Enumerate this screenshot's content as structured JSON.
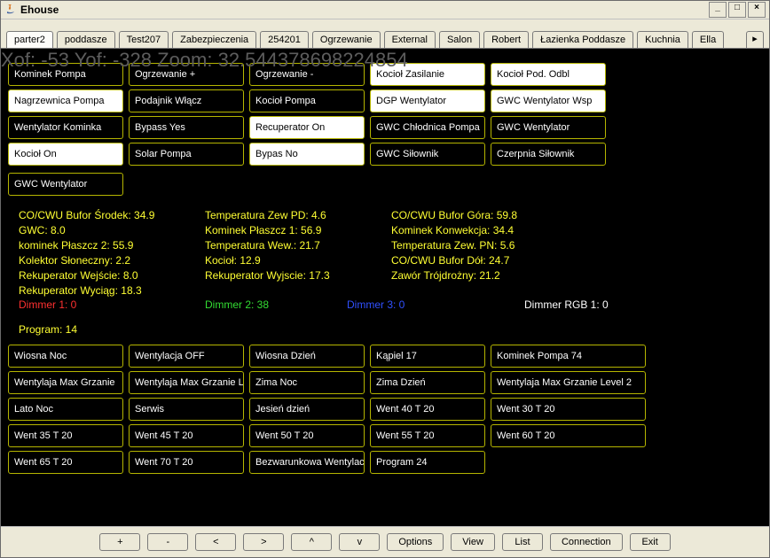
{
  "window": {
    "title": "Ehouse",
    "min_label": "_",
    "max_label": "□",
    "close_label": "×"
  },
  "tabs": {
    "items": [
      "parter2",
      "poddasze",
      "Test207",
      "Zabezpieczenia",
      "254201",
      "Ogrzewanie",
      "External",
      "Salon",
      "Robert",
      "Łazienka Poddasze",
      "Kuchnia",
      "Ella"
    ],
    "active_index": 0,
    "nav_right": "▸"
  },
  "overlay": "Xof: -53 Yof: -328 Zoom: 32.544378698224854",
  "devices": [
    {
      "label": "Kominek Pompa",
      "on": false
    },
    {
      "label": "Ogrzewanie +",
      "on": false
    },
    {
      "label": "Ogrzewanie -",
      "on": false
    },
    {
      "label": "Kocioł Zasilanie",
      "on": true
    },
    {
      "label": "Kocioł Pod. Odbl",
      "on": true
    },
    {
      "label": "Nagrzewnica Pompa",
      "on": true
    },
    {
      "label": "Podajnik Włącz",
      "on": false
    },
    {
      "label": "Kocioł Pompa",
      "on": false
    },
    {
      "label": "DGP Wentylator",
      "on": true
    },
    {
      "label": "GWC Wentylator Wsp",
      "on": true
    },
    {
      "label": "Wentylator Kominka",
      "on": false
    },
    {
      "label": "Bypass Yes",
      "on": false
    },
    {
      "label": "Recuperator On",
      "on": true
    },
    {
      "label": "GWC Chłodnica Pompa",
      "on": false
    },
    {
      "label": "GWC Wentylator",
      "on": false
    },
    {
      "label": "Kocioł On",
      "on": true
    },
    {
      "label": "Solar Pompa",
      "on": false
    },
    {
      "label": "Bypas No",
      "on": true
    },
    {
      "label": "GWC Siłownik",
      "on": false
    },
    {
      "label": "Czerpnia Siłownik",
      "on": false
    },
    {
      "label": "GWC Wentylator",
      "on": false
    }
  ],
  "sensors": {
    "col1": [
      "CO/CWU Bufor Środek: 34.9",
      "GWC: 8.0",
      "kominek Płaszcz 2: 55.9",
      "Kolektor Słoneczny: 2.2",
      "Rekuperator Wejście: 8.0",
      "Rekuperator Wyciąg: 18.3"
    ],
    "col2": [
      "Temperatura Zew PD: 4.6",
      "Kominek Płaszcz 1: 56.9",
      "Temperatura Wew.: 21.7",
      "Kocioł: 12.9",
      "Rekuperator Wyjscie: 17.3"
    ],
    "col3": [
      "CO/CWU Bufor Góra: 59.8",
      "Kominek Konwekcja: 34.4",
      "Temperatura Zew. PN: 5.6",
      "CO/CWU Bufor Dół: 24.7",
      "Zawór Trójdrożny: 21.2"
    ]
  },
  "dimmers": {
    "d1": "Dimmer 1: 0",
    "d2": "Dimmer 2: 38",
    "d3": "Dimmer 3: 0",
    "rgb": "Dimmer RGB 1: 0"
  },
  "program_line": "Program: 14",
  "programs": [
    "Wiosna Noc",
    "Wentylacja OFF",
    "Wiosna Dzień",
    "Kąpiel 17",
    "Kominek Pompa 74",
    "Wentylaja Max Grzanie",
    "Wentylaja Max Grzanie L",
    "Zima Noc",
    "Zima Dzień",
    "Wentylaja Max Grzanie Level 2",
    "Lato Noc",
    "Serwis",
    "Jesień dzień",
    "Went 40 T 20",
    "Went 30 T 20",
    "Went 35 T 20",
    "Went 45 T 20",
    "Went 50 T 20",
    "Went 55 T 20",
    "Went 60 T 20",
    "Went 65 T 20",
    "Went 70 T 20",
    "Bezwarunkowa Wentylacja",
    "Program 24"
  ],
  "bottom": {
    "plus": "+",
    "minus": "-",
    "lt": "<",
    "gt": ">",
    "up": "^",
    "down": "v",
    "options": "Options",
    "view": "View",
    "list": "List",
    "connection": "Connection",
    "exit": "Exit"
  }
}
